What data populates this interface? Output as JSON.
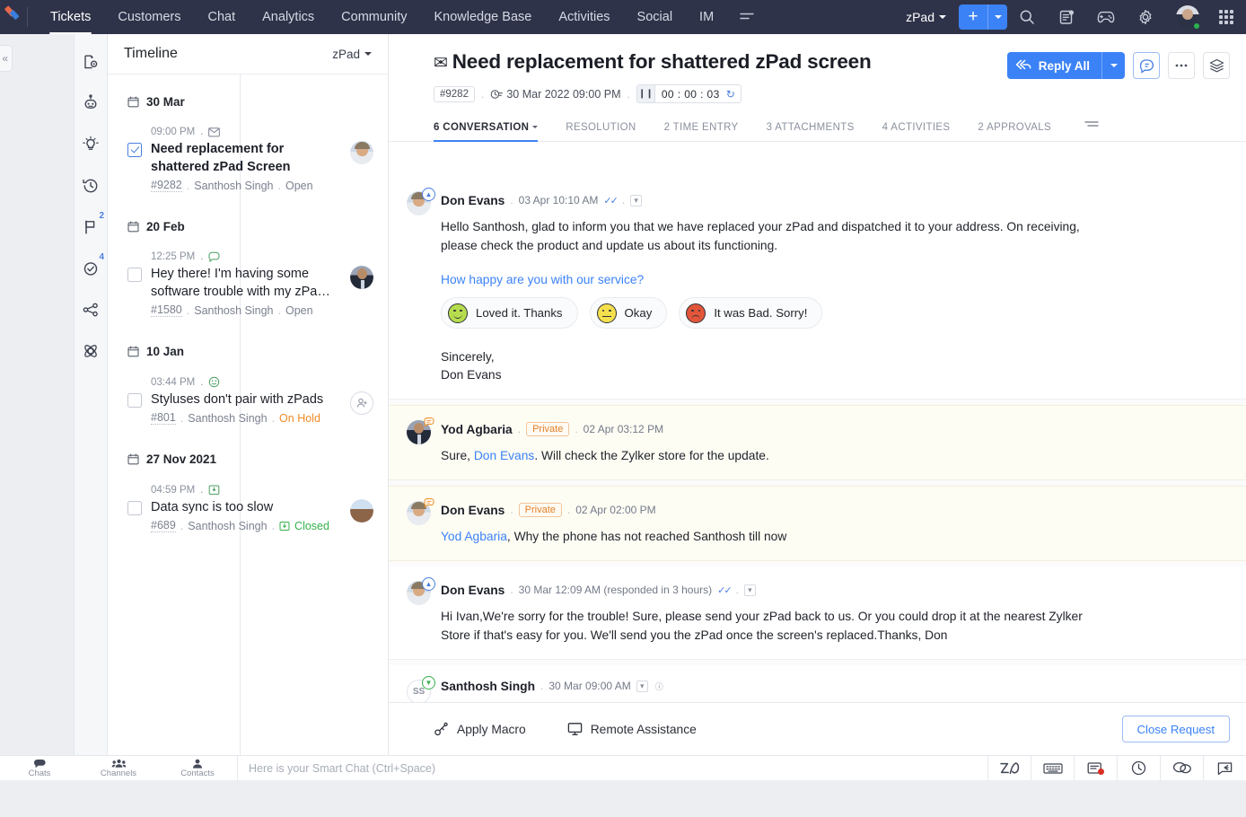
{
  "topnav": {
    "items": [
      {
        "label": "Tickets",
        "active": true
      },
      {
        "label": "Customers",
        "active": false
      },
      {
        "label": "Chat",
        "active": false
      },
      {
        "label": "Analytics",
        "active": false
      },
      {
        "label": "Community",
        "active": false
      },
      {
        "label": "Knowledge Base",
        "active": false
      },
      {
        "label": "Activities",
        "active": false
      },
      {
        "label": "Social",
        "active": false
      },
      {
        "label": "IM",
        "active": false
      }
    ],
    "more_label": "☰",
    "department": "zPad",
    "add_label": "+",
    "icons": [
      "search-icon",
      "notes-icon",
      "gamification-icon",
      "settings-icon",
      "user-avatar",
      "apps-grid-icon"
    ]
  },
  "left_rail": {
    "collapse_label": "«",
    "icons": [
      {
        "name": "contact-settings-icon",
        "badge": ""
      },
      {
        "name": "bot-icon",
        "badge": ""
      },
      {
        "name": "insights-bulb-icon",
        "badge": ""
      },
      {
        "name": "history-clock-icon",
        "badge": "",
        "selected": true
      },
      {
        "name": "flag-icon",
        "badge": "2"
      },
      {
        "name": "approvals-check-icon",
        "badge": "4"
      },
      {
        "name": "share-icon",
        "badge": ""
      },
      {
        "name": "blueprint-icon",
        "badge": ""
      }
    ]
  },
  "timeline": {
    "title": "Timeline",
    "filter": "zPad",
    "groups": [
      {
        "date": "30 Mar",
        "items": [
          {
            "time": "09:00 PM",
            "channel_icon": "email-icon",
            "subject": "Need replacement for shattered zPad Screen",
            "ticket_id": "#9282",
            "contact": "Santhosh Singh",
            "status": "Open",
            "status_kind": "open",
            "checked": true,
            "avatar": "don",
            "selected": true
          }
        ]
      },
      {
        "date": "20 Feb",
        "items": [
          {
            "time": "12:25 PM",
            "channel_icon": "chat-icon",
            "subject": "Hey there! I'm having some software trouble with my zPa…",
            "ticket_id": "#1580",
            "contact": "Santhosh Singh",
            "status": "Open",
            "status_kind": "open",
            "checked": false,
            "avatar": "yod",
            "selected": false
          }
        ]
      },
      {
        "date": "10 Jan",
        "items": [
          {
            "time": "03:44 PM",
            "channel_icon": "feedback-icon",
            "subject": "Styluses don't pair with zPads",
            "ticket_id": "#801",
            "contact": "Santhosh Singh",
            "status": "On Hold",
            "status_kind": "hold",
            "checked": false,
            "avatar": "anon",
            "selected": false
          }
        ]
      },
      {
        "date": "27 Nov 2021",
        "items": [
          {
            "time": "04:59 PM",
            "channel_icon": "inbox-icon",
            "subject": "Data sync is too slow",
            "ticket_id": "#689",
            "contact": "Santhosh Singh",
            "status": "Closed",
            "status_kind": "closed",
            "checked": false,
            "avatar": "woman",
            "selected": false
          }
        ]
      }
    ]
  },
  "ticket": {
    "channel_icon": "email-icon",
    "title": "Need replacement for shattered zPad screen",
    "id": "#9282",
    "due": "30 Mar 2022 09:00 PM",
    "timer": "00 : 00 : 03",
    "actions": {
      "reply_all": "Reply All",
      "comment_icon": "comment-icon",
      "more_icon": "more-icon",
      "layers_icon": "layers-icon"
    },
    "tabs": [
      {
        "label": "6 CONVERSATION",
        "active": true,
        "caret": true
      },
      {
        "label": "RESOLUTION",
        "active": false,
        "caret": false
      },
      {
        "label": "2 TIME ENTRY",
        "active": false,
        "caret": false
      },
      {
        "label": "3 ATTACHMENTS",
        "active": false,
        "caret": false
      },
      {
        "label": "4 ACTIVITIES",
        "active": false,
        "caret": false
      },
      {
        "label": "2 APPROVALS",
        "active": false,
        "caret": false
      }
    ],
    "tabs_more_icon": "tabs-more-icon"
  },
  "conversation": [
    {
      "author": "Don Evans",
      "avatar": "don",
      "badge": "outgoing",
      "private": false,
      "timestamp": "03 Apr 10:10 AM",
      "has_tick": true,
      "body": "Hello Santhosh, glad to inform you that we have replaced your zPad and dispatched it to your address. On receiving, please check the product and update us about its functioning.",
      "survey": {
        "question": "How happy are you with our service?",
        "options": [
          {
            "label": "Loved it. Thanks",
            "mood": "happy",
            "color": "#b7dd4e"
          },
          {
            "label": "Okay",
            "mood": "neutral",
            "color": "#f4e04d"
          },
          {
            "label": "It was Bad. Sorry!",
            "mood": "sad",
            "color": "#e2553a"
          }
        ]
      },
      "signature": "Sincerely,\nDon Evans"
    },
    {
      "author": "Yod Agbaria",
      "avatar": "yod",
      "badge": "note",
      "private": true,
      "private_label": "Private",
      "timestamp": "02 Apr 03:12 PM",
      "has_tick": false,
      "body_pre": "Sure, ",
      "body_link": "Don Evans",
      "body_post": ". Will check the Zylker store for the update."
    },
    {
      "author": "Don Evans",
      "avatar": "don",
      "badge": "note",
      "private": true,
      "private_label": "Private",
      "timestamp": "02 Apr 02:00 PM",
      "has_tick": false,
      "body_link": "Yod Agbaria",
      "body_post": ",  Why the phone has not reached Santhosh till now"
    },
    {
      "author": "Don Evans",
      "avatar": "don",
      "badge": "outgoing",
      "private": false,
      "timestamp": "30 Mar 12:09 AM (responded in 3 hours)",
      "has_tick": true,
      "body": "Hi Ivan,We're sorry for the trouble! Sure, please send your zPad back to us. Or you could drop it at the nearest Zylker Store if that's easy for you. We'll send you the zPad once the screen's replaced.Thanks, Don"
    },
    {
      "author": "Santhosh Singh",
      "avatar": "ss",
      "avatar_initials": "SS",
      "badge": "incoming",
      "private": false,
      "timestamp": "30 Mar 09:00 AM",
      "has_tick": false,
      "body": ""
    }
  ],
  "footer": {
    "apply_macro": "Apply Macro",
    "remote_assistance": "Remote Assistance",
    "close_request": "Close Request"
  },
  "chatbar": {
    "items": [
      {
        "label": "Chats",
        "icon": "chat-bubble-icon"
      },
      {
        "label": "Channels",
        "icon": "channels-icon"
      },
      {
        "label": "Contacts",
        "icon": "contacts-icon"
      }
    ],
    "placeholder": "Here is your Smart Chat (Ctrl+Space)",
    "right_icons": [
      "zia-icon",
      "keyboard-icon",
      "notes-badge-icon",
      "clock-icon",
      "chat-icon",
      "reply-icon"
    ]
  },
  "colors": {
    "nav_bg": "#2f3349",
    "accent": "#3b82f6",
    "status_open": "#7b8190",
    "status_hold": "#f08c26",
    "status_closed": "#35b14a",
    "private_bg": "#fefdf4"
  }
}
